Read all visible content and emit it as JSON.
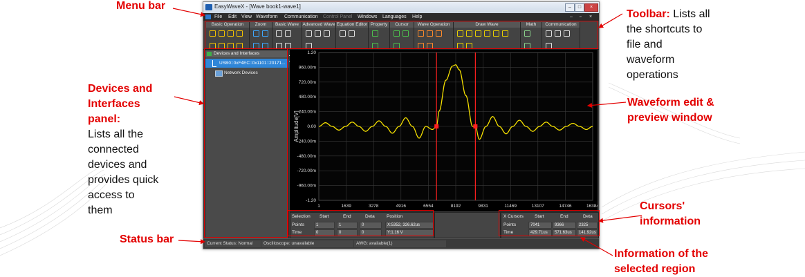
{
  "app": {
    "title": "EasyWaveX - [Wave book1-wave1]",
    "controls": {
      "minimize": "–",
      "restore": "□",
      "close": "×"
    }
  },
  "menu": [
    "File",
    "Edit",
    "View",
    "Waveform",
    "Communication",
    "Control Panel",
    "Windows",
    "Languages",
    "Help"
  ],
  "menu_disabled": [
    "Control Panel"
  ],
  "toolbar_groups": [
    {
      "label": "Basic Operation",
      "icons": [
        "new-icon",
        "open-icon",
        "save-icon",
        "undo-icon",
        "cut-icon",
        "copy-icon",
        "paste-icon",
        "redo-icon"
      ]
    },
    {
      "label": "Zoom",
      "icons": [
        "zoom-in-icon",
        "zoom-out-icon",
        "zoom-fit-icon",
        "zoom-reset-icon"
      ]
    },
    {
      "label": "Basic Wave",
      "icons": [
        "sine-icon",
        "square-icon",
        "pulse-icon",
        "ramp-icon",
        "noise-icon",
        "dc-icon"
      ]
    },
    {
      "label": "Advanced Wave",
      "icons": [
        "exp-rise-icon",
        "exp-fall-icon",
        "sinc-icon",
        "arb-icon"
      ]
    },
    {
      "label": "Equation Editor",
      "icons": [
        "fx-icon",
        "ab-icon"
      ]
    },
    {
      "label": "Property",
      "icons": [
        "property-icon",
        "info-icon"
      ]
    },
    {
      "label": "Cursor",
      "icons": [
        "cursor-x-icon",
        "cursor-y-icon",
        "cursor-track-icon"
      ]
    },
    {
      "label": "Wave Operation",
      "icons": [
        "cut-wave-icon",
        "stretch-icon",
        "crop-icon",
        "join-icon",
        "split-icon"
      ]
    },
    {
      "label": "Draw Wave",
      "icons": [
        "pen-icon",
        "line-icon",
        "curve-icon",
        "check-icon",
        "point-icon",
        "fill-icon",
        "eraser-icon",
        "smooth-icon"
      ]
    },
    {
      "label": "Math",
      "icons": [
        "grid-math-icon",
        "flip-icon",
        "matrix-icon"
      ]
    },
    {
      "label": "Communication",
      "icons": [
        "download-icon",
        "upload-icon",
        "sync-icon",
        "link-icon"
      ]
    }
  ],
  "devices": {
    "header": "Devices and Interfaces",
    "selected": "USB0::0xF4EC::0x1101::20171...",
    "network": "Network Devices"
  },
  "plot": {
    "ylabel": "Amplitude[V]",
    "yticks": [
      "1.20",
      "960.00m",
      "720.00m",
      "480.00m",
      "240.00m",
      "0.00",
      "-240.00m",
      "-480.00m",
      "-720.00m",
      "-960.00m",
      "-1.20"
    ],
    "xticks": [
      "1",
      "1639",
      "3278",
      "4916",
      "6554",
      "8192",
      "9831",
      "11469",
      "13107",
      "14746",
      "16384"
    ],
    "colors": {
      "background": "#000000",
      "grid": "#3a3a3a",
      "wave": "#f5e000",
      "cursor": "#ff2020"
    }
  },
  "chart_data": {
    "type": "line",
    "title": "",
    "xlabel": "",
    "ylabel": "Amplitude[V]",
    "xlim": [
      1,
      16384
    ],
    "ylim": [
      -1.2,
      1.2
    ],
    "series": [
      {
        "x": [
          1,
          400,
          800,
          1200,
          1600,
          2000,
          2400,
          2800,
          3200,
          3600,
          4000,
          4400,
          4800,
          5200,
          5600,
          6000,
          6400,
          6800,
          7041,
          7200,
          7600,
          8000,
          8192,
          8400,
          8800,
          9200,
          9366,
          9600,
          10000,
          10400,
          10800,
          11200,
          11600,
          12000,
          12400,
          12800,
          13200,
          13600,
          14000,
          14400,
          14800,
          15200,
          15600,
          16000,
          16384
        ],
        "y": [
          0.0,
          0.06,
          0.0,
          -0.06,
          0.0,
          0.07,
          0.0,
          -0.08,
          0.0,
          0.09,
          0.0,
          -0.11,
          0.0,
          0.14,
          0.0,
          -0.19,
          0.0,
          -0.05,
          0.0,
          0.25,
          0.75,
          0.98,
          1.0,
          0.92,
          0.5,
          0.0,
          0.0,
          -0.21,
          0.0,
          0.16,
          0.0,
          -0.12,
          0.0,
          0.1,
          0.0,
          -0.08,
          0.0,
          0.07,
          0.0,
          -0.06,
          0.0,
          0.05,
          0.0,
          -0.05,
          0.0
        ]
      }
    ],
    "cursors_x": [
      7041,
      9366
    ],
    "grid": true
  },
  "selection": {
    "headers": [
      "Selection",
      "Start",
      "End",
      "Deta"
    ],
    "rows": [
      {
        "label": "Points",
        "start": "1",
        "end": "1",
        "deta": "0"
      },
      {
        "label": "Time",
        "start": "0",
        "end": "0",
        "deta": "0"
      }
    ],
    "position_header": "Position",
    "position": [
      "X:5352, 326.62us",
      "Y:1.16 V"
    ]
  },
  "xcursors": {
    "headers": [
      "X Cursors",
      "Start",
      "End",
      "Deta"
    ],
    "rows": [
      {
        "label": "Points",
        "start": "7041",
        "end": "9366",
        "deta": "2325"
      },
      {
        "label": "Time",
        "start": "429.71us",
        "end": "571.63us",
        "deta": "141.92us"
      }
    ]
  },
  "status": {
    "current": "Current Status: Normal",
    "osc": "Oscilloscope: unavailable",
    "awg": "AWG: available(1)"
  },
  "annotations": {
    "menu_bar": "Menu bar",
    "toolbar_title": "Toolbar:",
    "toolbar_desc": [
      " Lists all",
      "the shortcuts to",
      "file and",
      "waveform",
      "operations"
    ],
    "devices_title": [
      "Devices and",
      "Interfaces",
      "panel:"
    ],
    "devices_desc": [
      "Lists all the",
      "connected",
      "devices and",
      "provides quick",
      "access to",
      "them"
    ],
    "waveform": [
      "Waveform edit &",
      "preview window"
    ],
    "status_bar": "Status bar",
    "cursors": [
      "Cursors'",
      "information"
    ],
    "selected_region": [
      "Information of the",
      "selected region"
    ]
  },
  "accent": "#e30000"
}
